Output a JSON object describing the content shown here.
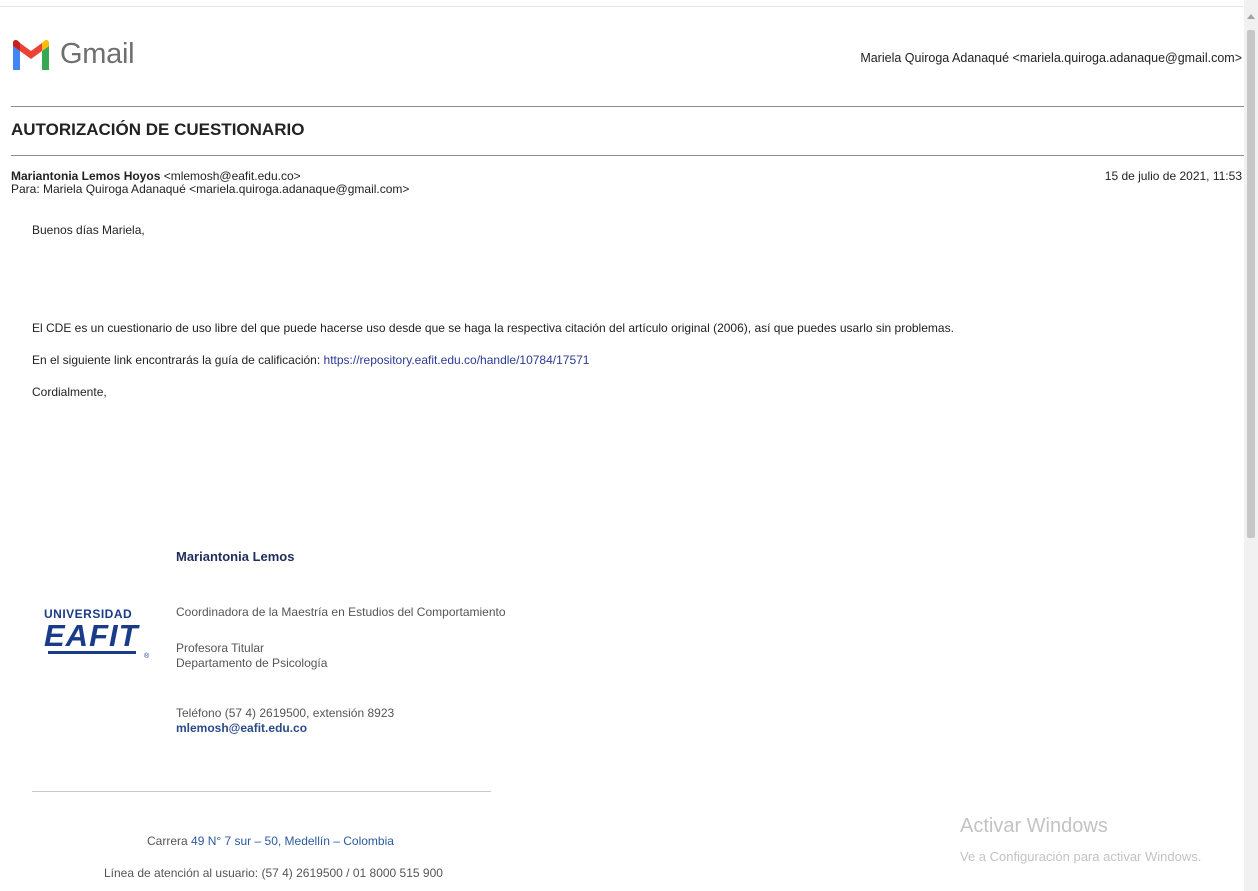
{
  "header": {
    "app_name": "Gmail",
    "logo_icon": "gmail-m-logo",
    "account": "Mariela Quiroga Adanaqué <mariela.quiroga.adanaque@gmail.com>"
  },
  "email": {
    "subject": "AUTORIZACIÓN DE CUESTIONARIO",
    "from_name": "Mariantonia Lemos Hoyos",
    "from_address": " <mlemosh@eafit.edu.co>",
    "to": "Para: Mariela Quiroga Adanaqué <mariela.quiroga.adanaque@gmail.com>",
    "date": "15 de julio de 2021, 11:53",
    "greeting": "Buenos días Mariela,",
    "body_1": "El CDE es un cuestionario de uso libre del que puede hacerse uso desde que se haga la respectiva citación del artículo original (2006), así que puedes usarlo sin problemas.",
    "body_2_prefix": "En el siguiente link encontrarás la guía de calificación: ",
    "body_2_link": "https://repository.eafit.edu.co/handle/10784/17571",
    "closing": "Cordialmente,"
  },
  "signature": {
    "name": "Mariantonia Lemos",
    "role": "Coordinadora de la Maestría en Estudios del Comportamiento",
    "title_1": "Profesora Titular",
    "title_2": "Departamento de Psicología",
    "phone": "Teléfono (57 4) 2619500, extensión 8923",
    "email": "mlemosh@eafit.edu.co",
    "logo_top": "UNIVERSIDAD",
    "logo_main": "EAFIT",
    "logo_reg": "®",
    "brand_color": "#1a3a8a"
  },
  "footer": {
    "address_prefix": "Carrera ",
    "address_link": "49 N° 7 sur – 50, Medellín – Colombia",
    "hotline": "Línea de atención al usuario: (57 4) 2619500 / 01 8000 515 900"
  },
  "watermark": {
    "line1": "Activar Windows",
    "line2": "Ve a Configuración para activar Windows."
  }
}
